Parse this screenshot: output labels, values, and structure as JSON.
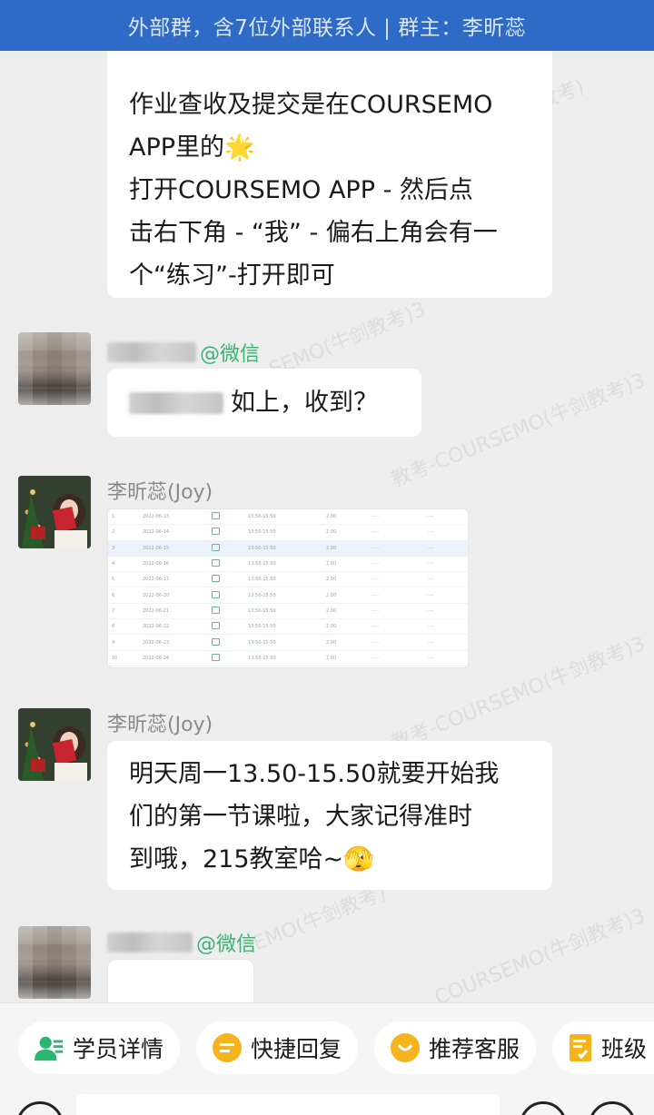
{
  "header": {
    "title": "外部群，含7位外部联系人 | 群主：李昕蕊"
  },
  "messages": {
    "m1": {
      "text": "作业查收及提交是在COURSEMO\nAPP里的🌟\n打开COURSEMO APP - 然后点\n击右下角 - “我” - 偏右上角会有一\n个“练习”-打开即可"
    },
    "m2": {
      "sender_tag": "@微信",
      "text": "如上，收到？"
    },
    "m3": {
      "sender": "李昕蕊(Joy)"
    },
    "m4": {
      "sender": "李昕蕊(Joy)",
      "text": "明天周一13.50-15.50就要开始我\n们的第一节课啦，大家记得准时\n到哦，215教室哈~🫣"
    },
    "m5": {
      "sender_tag": "@微信"
    }
  },
  "toolbar": {
    "student_details": "学员详情",
    "quick_reply": "快捷回复",
    "recommend_service": "推荐客服",
    "class_level": "班级"
  },
  "colors": {
    "header_bg": "#2e6bc6",
    "wechat_tag": "#3cb371",
    "background": "#ededed",
    "bubble": "#ffffff"
  },
  "icons": [
    "student-details-icon",
    "quick-reply-icon",
    "recommend-service-icon",
    "class-level-icon",
    "voice-icon",
    "emoji-icon",
    "plus-icon"
  ]
}
